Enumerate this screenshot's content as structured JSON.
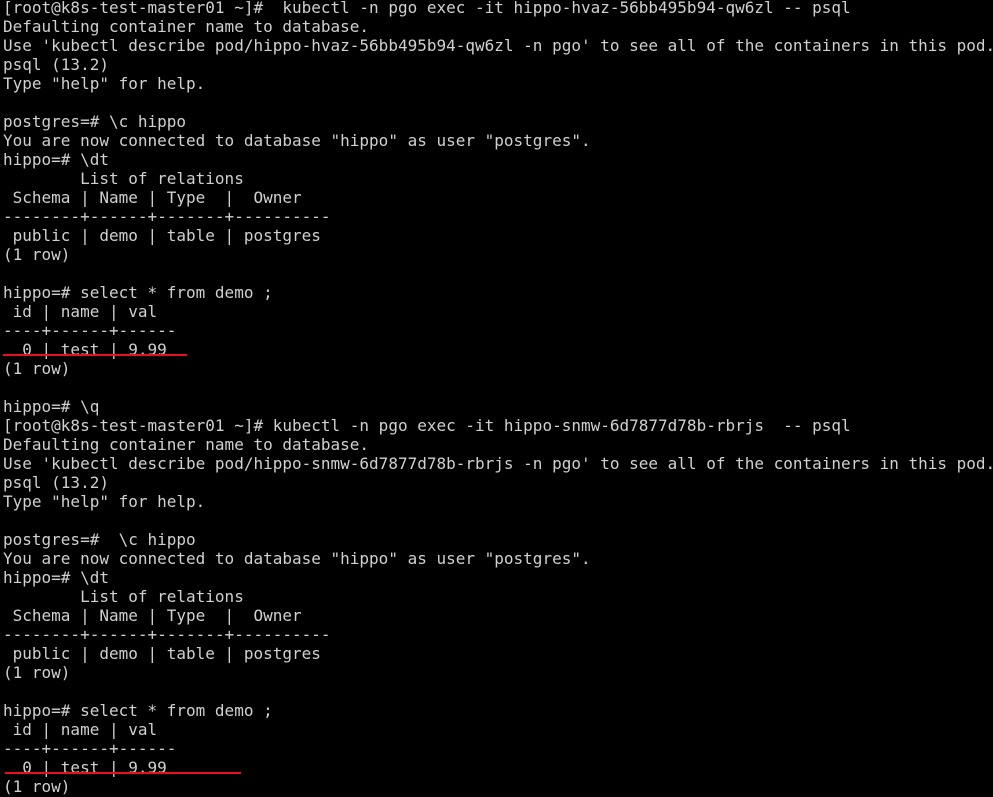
{
  "terminal": {
    "lines": [
      "[root@k8s-test-master01 ~]#  kubectl -n pgo exec -it hippo-hvaz-56bb495b94-qw6zl -- psql",
      "Defaulting container name to database.",
      "Use 'kubectl describe pod/hippo-hvaz-56bb495b94-qw6zl -n pgo' to see all of the containers in this pod.",
      "psql (13.2)",
      "Type \"help\" for help.",
      "",
      "postgres=# \\c hippo",
      "You are now connected to database \"hippo\" as user \"postgres\".",
      "hippo=# \\dt",
      "        List of relations",
      " Schema | Name | Type  |  Owner",
      "--------+------+-------+----------",
      " public | demo | table | postgres",
      "(1 row)",
      "",
      "hippo=# select * from demo ;",
      " id | name | val",
      "----+------+------",
      "  0 | test | 9.99",
      "(1 row)",
      "",
      "hippo=# \\q",
      "[root@k8s-test-master01 ~]# kubectl -n pgo exec -it hippo-snmw-6d7877d78b-rbrjs  -- psql",
      "Defaulting container name to database.",
      "Use 'kubectl describe pod/hippo-snmw-6d7877d78b-rbrjs -n pgo' to see all of the containers in this pod.",
      "psql (13.2)",
      "Type \"help\" for help.",
      "",
      "postgres=#  \\c hippo",
      "You are now connected to database \"hippo\" as user \"postgres\".",
      "hippo=# \\dt",
      "        List of relations",
      " Schema | Name | Type  |  Owner",
      "--------+------+-------+----------",
      " public | demo | table | postgres",
      "(1 row)",
      "",
      "hippo=# select * from demo ;",
      " id | name | val",
      "----+------+------",
      "  0 | test | 9.99",
      "(1 row)"
    ]
  },
  "colors": {
    "background": "#000000",
    "text": "#d0d0d0",
    "annotation_underline": "#e8101a"
  }
}
